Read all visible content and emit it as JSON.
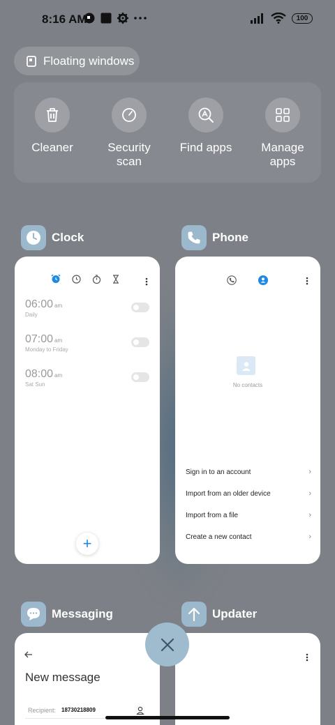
{
  "status_bar": {
    "time": "8:16 AM",
    "left_icons": [
      "app-badge-icon",
      "square-notification-icon",
      "gear-icon",
      "more-dots-icon"
    ],
    "right_icons": [
      "signal-icon",
      "wifi-icon"
    ],
    "battery": "100"
  },
  "floating_windows": {
    "label": "Floating windows",
    "icon": "floating-window-icon"
  },
  "quick_actions": [
    {
      "label": "Cleaner",
      "icon": "trash-icon"
    },
    {
      "label": "Security\nscan",
      "icon": "security-scan-icon"
    },
    {
      "label": "Find apps",
      "icon": "find-apps-icon"
    },
    {
      "label": "Manage\napps",
      "icon": "grid-apps-icon"
    }
  ],
  "apps": {
    "clock": {
      "name": "Clock",
      "tabs": [
        "alarm-icon",
        "clock-icon",
        "stopwatch-icon",
        "timer-icon"
      ],
      "alarms": [
        {
          "time": "06:00",
          "period": "am",
          "repeat": "Daily",
          "enabled": false
        },
        {
          "time": "07:00",
          "period": "am",
          "repeat": "Monday to Friday",
          "enabled": false
        },
        {
          "time": "08:00",
          "period": "am",
          "repeat": "Sat Sun",
          "enabled": false
        }
      ],
      "fab": "+"
    },
    "phone": {
      "name": "Phone",
      "empty_text": "No contacts",
      "options": [
        "Sign in to an account",
        "Import from an older device",
        "Import from a file",
        "Create a new contact"
      ]
    },
    "messaging": {
      "name": "Messaging",
      "title": "New message",
      "recipient_label": "Recipient:",
      "recipient_number": "18730218809"
    },
    "updater": {
      "name": "Updater"
    }
  },
  "close_button": "close-icon",
  "colors": {
    "background": "#7d8187",
    "accent_blue": "#1e88e5",
    "app_icon_bg": "#9cb8cc",
    "close_bg": "#9fbccf"
  }
}
